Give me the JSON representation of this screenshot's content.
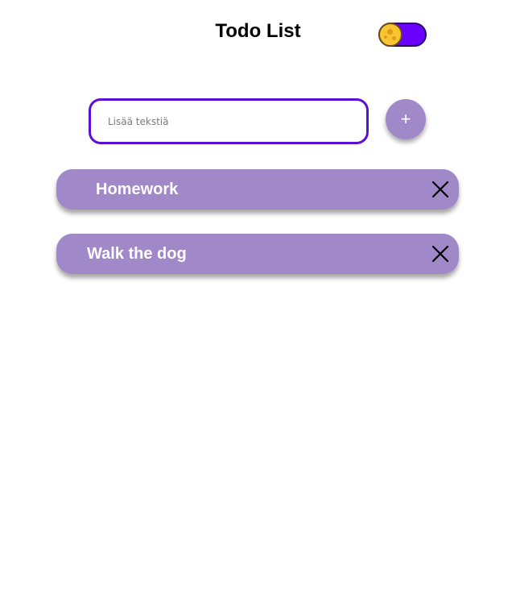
{
  "header": {
    "title": "Todo List",
    "theme_toggle": {
      "state": "dark",
      "track_color": "#6a00ff",
      "knob_color": "#f6c531",
      "knob_icon": "moon-icon"
    }
  },
  "input": {
    "value": "",
    "placeholder": "Lisää tekstiä",
    "border_color": "#5b0fd4"
  },
  "add_button": {
    "label": "+"
  },
  "todos": [
    {
      "text": "Homework"
    },
    {
      "text": "Walk the dog"
    }
  ],
  "colors": {
    "item_background": "#a088c9",
    "item_text": "#ffffff"
  },
  "icons": {
    "delete": "close-icon"
  }
}
